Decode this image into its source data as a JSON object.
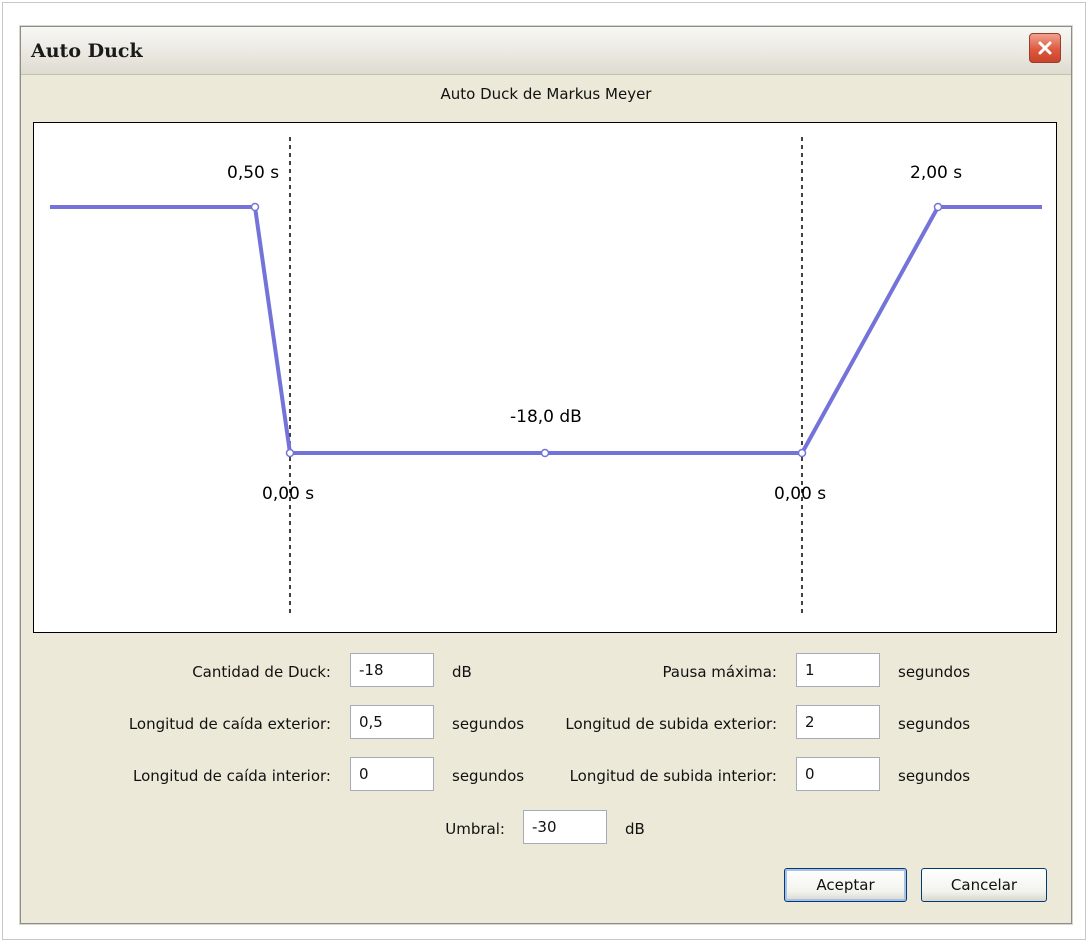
{
  "window": {
    "title": "Auto Duck",
    "close_icon": "close-icon",
    "subtitle": "Auto Duck de Markus Meyer"
  },
  "graph": {
    "outer_fade_down": "0,50 s",
    "inner_fade_down": "0,00 s",
    "duck_amount": "-18,0 dB",
    "inner_fade_up": "0,00 s",
    "outer_fade_up": "2,00 s",
    "line_color": "#7373d9"
  },
  "fields": {
    "duck_amount": {
      "label": "Cantidad de Duck:",
      "value": "-18",
      "unit": "dB"
    },
    "outer_fade_down": {
      "label": "Longitud de caída exterior:",
      "value": "0,5",
      "unit": "segundos"
    },
    "inner_fade_down": {
      "label": "Longitud de caída interior:",
      "value": "0",
      "unit": "segundos"
    },
    "max_pause": {
      "label": "Pausa máxima:",
      "value": "1",
      "unit": "segundos"
    },
    "outer_fade_up": {
      "label": "Longitud de subida exterior:",
      "value": "2",
      "unit": "segundos"
    },
    "inner_fade_up": {
      "label": "Longitud de subida interior:",
      "value": "0",
      "unit": "segundos"
    },
    "threshold": {
      "label": "Umbral:",
      "value": "-30",
      "unit": "dB"
    }
  },
  "buttons": {
    "ok": "Aceptar",
    "cancel": "Cancelar"
  }
}
